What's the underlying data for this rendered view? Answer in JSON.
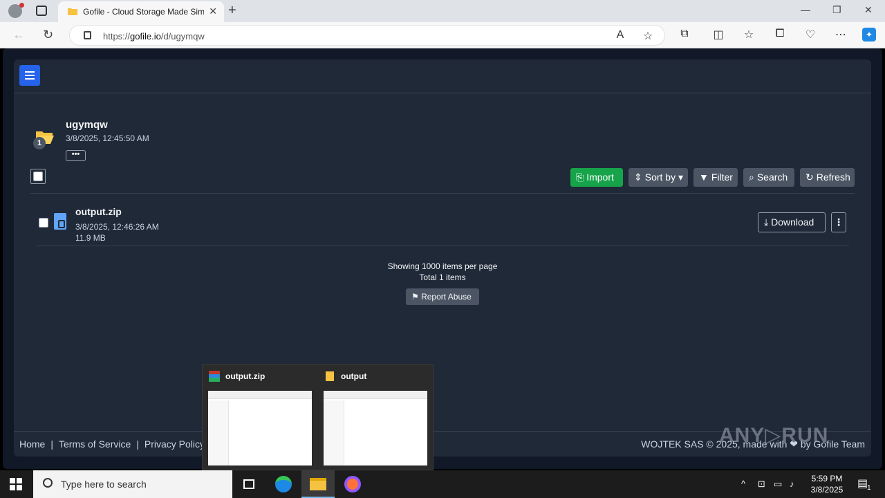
{
  "browser": {
    "tab_title": "Gofile - Cloud Storage Made Sim",
    "url_prefix": "https://",
    "url_host": "gofile.io",
    "url_path": "/d/ugymqw"
  },
  "folder": {
    "name": "ugymqw",
    "date": "3/8/2025, 12:45:50 AM",
    "badge": "1",
    "more_label": "•••"
  },
  "toolbar": {
    "import_label": "Import",
    "sortby_label": "Sort by",
    "filter_label": "Filter",
    "search_label": "Search",
    "refresh_label": "Refresh"
  },
  "files": [
    {
      "name": "output.zip",
      "date": "3/8/2025, 12:46:26 AM",
      "size": "11.9 MB",
      "download_label": "Download"
    }
  ],
  "pagination": {
    "per_page_text": "Showing 1000 items per page",
    "total_text": "Total 1 items",
    "report_label": "Report Abuse"
  },
  "footer": {
    "links": [
      "Home",
      "Terms of Service",
      "Privacy Policy"
    ],
    "right_text": "WOJTEK SAS © 2025, made with ❤ by Gofile Team"
  },
  "watermark": "ANY▷RUN",
  "taskbar_preview": {
    "windows": [
      {
        "title": "output.zip"
      },
      {
        "title": "output"
      }
    ]
  },
  "taskbar": {
    "search_placeholder": "Type here to search",
    "time": "5:59 PM",
    "date": "3/8/2025",
    "notification_count": "1"
  },
  "colors": {
    "accent_blue": "#2563eb",
    "import_green": "#16a34a",
    "page_bg": "#111827",
    "card_bg": "#1f2937"
  }
}
